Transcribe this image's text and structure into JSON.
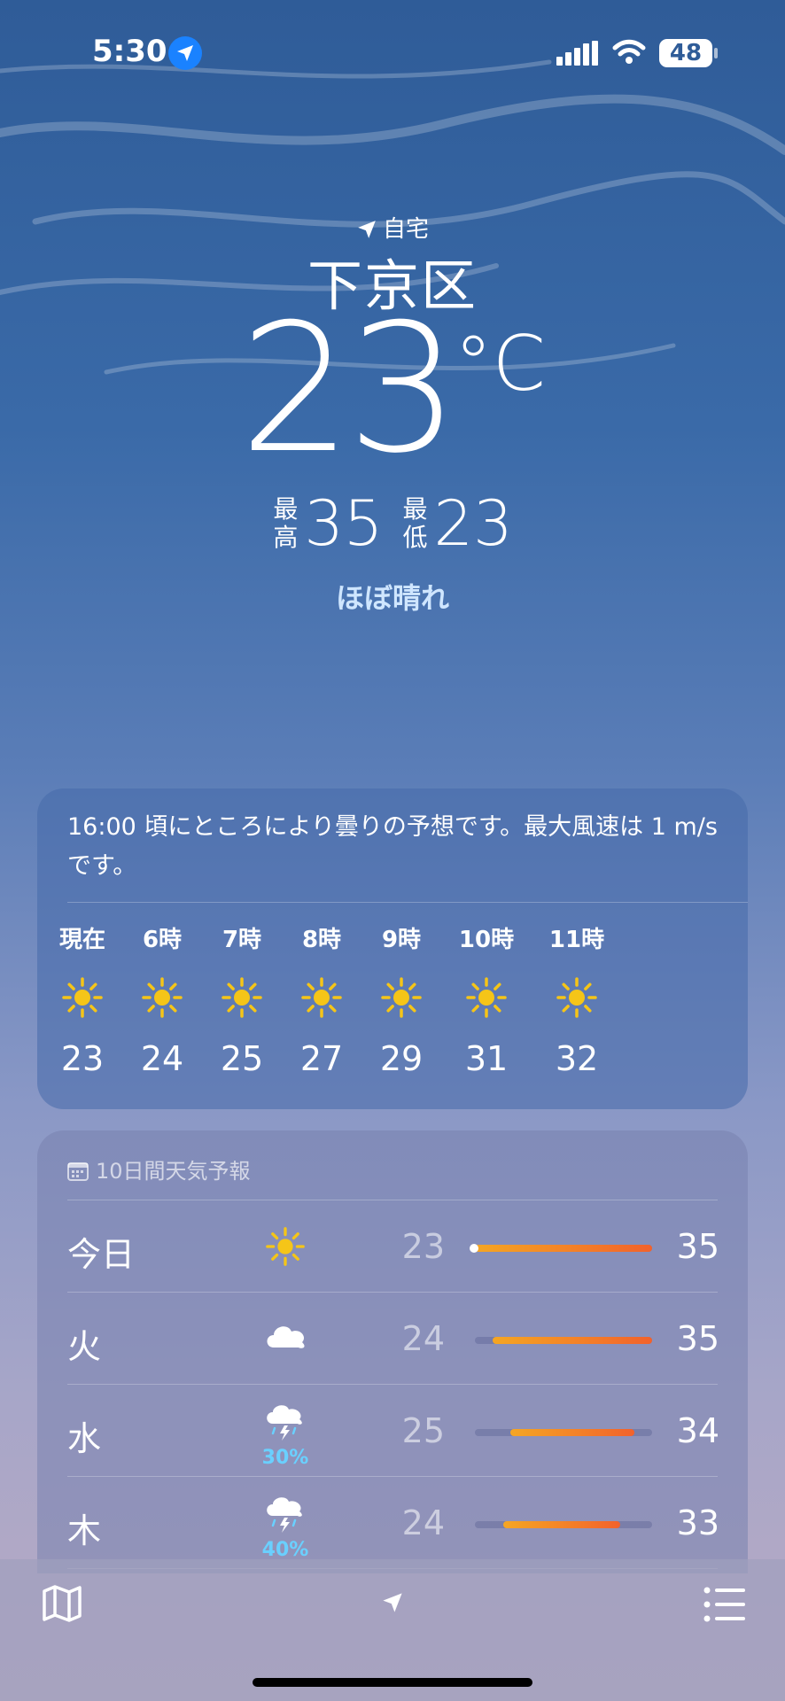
{
  "status": {
    "time": "5:30",
    "battery": "48"
  },
  "location": {
    "home_label": "自宅",
    "city": "下京区"
  },
  "current": {
    "temp": "23",
    "unit": "°C",
    "high_label": "最高",
    "high": "35",
    "low_label": "最低",
    "low": "23",
    "condition": "ほぼ晴れ"
  },
  "hourly": {
    "summary": "16:00 頃にところにより曇りの予想です。最大風速は 1 m/s です。",
    "items": [
      {
        "label": "現在",
        "icon": "sun-icon",
        "temp": "23"
      },
      {
        "label": "6時",
        "icon": "sun-icon",
        "temp": "24"
      },
      {
        "label": "7時",
        "icon": "sun-icon",
        "temp": "25"
      },
      {
        "label": "8時",
        "icon": "sun-icon",
        "temp": "27"
      },
      {
        "label": "9時",
        "icon": "sun-icon",
        "temp": "29"
      },
      {
        "label": "10時",
        "icon": "sun-icon",
        "temp": "31"
      },
      {
        "label": "11時",
        "icon": "sun-icon",
        "temp": "32"
      }
    ]
  },
  "daily": {
    "header": "10日間天気予報",
    "days": [
      {
        "name": "今日",
        "icon": "sun-icon",
        "pop": "",
        "low": "23",
        "high": "35",
        "range_start": 0.0,
        "range_end": 1.0
      },
      {
        "name": "火",
        "icon": "cloud-icon",
        "pop": "",
        "low": "24",
        "high": "35",
        "range_start": 0.1,
        "range_end": 1.0
      },
      {
        "name": "水",
        "icon": "thunderstorm-icon",
        "pop": "30%",
        "low": "25",
        "high": "34",
        "range_start": 0.2,
        "range_end": 0.9
      },
      {
        "name": "木",
        "icon": "thunderstorm-icon",
        "pop": "40%",
        "low": "24",
        "high": "33",
        "range_start": 0.16,
        "range_end": 0.82
      }
    ]
  },
  "colors": {
    "sun": "#f5c518",
    "bar_start": "#f5a623",
    "bar_end": "#f2622c",
    "pop": "#6ad0ff"
  }
}
